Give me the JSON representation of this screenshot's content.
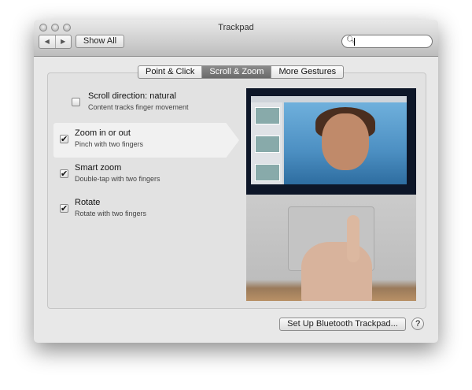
{
  "window": {
    "title": "Trackpad"
  },
  "toolbar": {
    "back": "◀",
    "forward": "▶",
    "show_all": "Show All",
    "search_placeholder": "",
    "search_icon": "magnifier"
  },
  "tabs": [
    {
      "label": "Point & Click",
      "selected": false
    },
    {
      "label": "Scroll & Zoom",
      "selected": true
    },
    {
      "label": "More Gestures",
      "selected": false
    }
  ],
  "options": [
    {
      "title": "Scroll direction: natural",
      "subtitle": "Content tracks finger movement",
      "checked": false,
      "check": ""
    },
    {
      "title": "Zoom in or out",
      "subtitle": "Pinch with two fingers",
      "checked": true,
      "check": "✔"
    },
    {
      "title": "Smart zoom",
      "subtitle": "Double-tap with two fingers",
      "checked": true,
      "check": "✔"
    },
    {
      "title": "Rotate",
      "subtitle": "Rotate with two fingers",
      "checked": true,
      "check": "✔"
    }
  ],
  "footer": {
    "setup_button": "Set Up Bluetooth Trackpad...",
    "help": "?"
  }
}
